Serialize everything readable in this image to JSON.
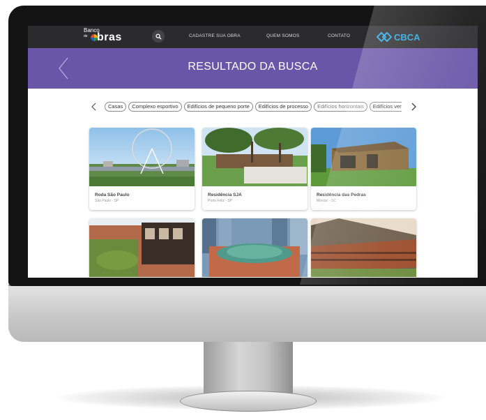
{
  "header": {
    "logo": {
      "line1": "Banco",
      "line2": "de",
      "line3": "bras"
    },
    "nav": [
      "CADASTRE SUA OBRA",
      "QUEM SOMOS",
      "CONTATO"
    ],
    "partner_logo": "CBCA"
  },
  "banner": {
    "title": "RESULTADO DA BUSCA"
  },
  "filters": {
    "chips": [
      "Casas",
      "Complexo esportivo",
      "Edifícios de pequeno porte",
      "Edifícios de processo",
      "Edifícios horizontais",
      "Edifícios verticais"
    ]
  },
  "results": [
    {
      "name": "Roda São Paulo",
      "location": "São Paulo - SP"
    },
    {
      "name": "Residência SJA",
      "location": "Porto Feliz - SP"
    },
    {
      "name": "Residência das Pedras",
      "location": "Mondaí - SC"
    },
    {
      "name": "",
      "location": ""
    },
    {
      "name": "",
      "location": ""
    },
    {
      "name": "",
      "location": ""
    }
  ],
  "colors": {
    "topbar": "#2b2b2d",
    "banner": "#6a56a8",
    "partner": "#27a7e0"
  },
  "icons": [
    "search-icon",
    "chevron-left-icon",
    "chevron-right-icon",
    "back-arrow-icon",
    "cbca-logo-icon"
  ]
}
